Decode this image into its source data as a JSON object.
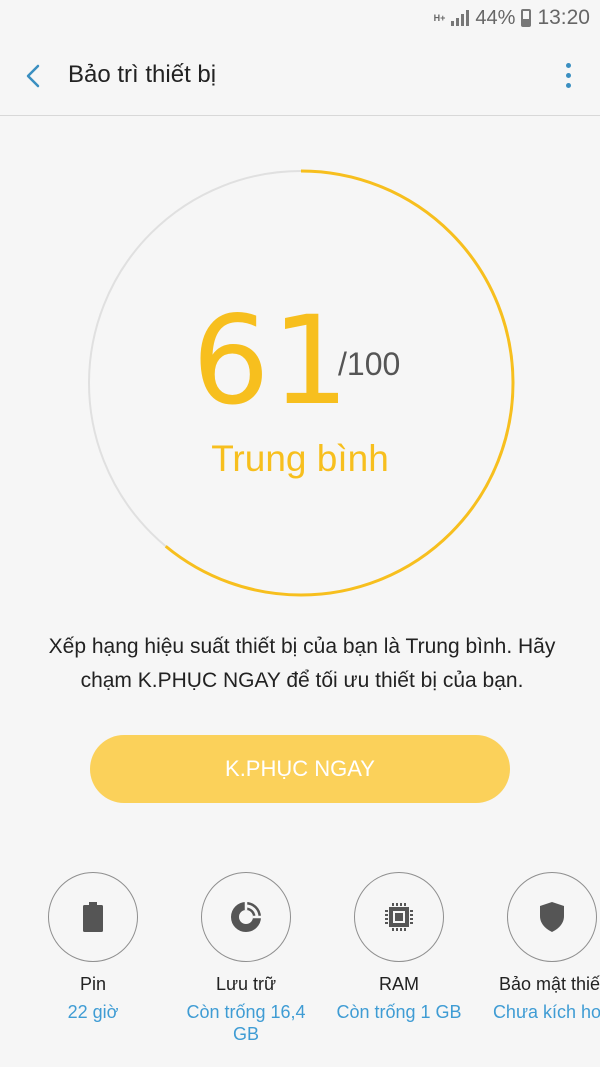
{
  "status_bar": {
    "network": "H+",
    "battery": "44%",
    "time": "13:20"
  },
  "header": {
    "title": "Bảo trì thiết bị",
    "back_icon": "chevron-left-icon",
    "more_icon": "more-vert-icon"
  },
  "score": {
    "value": "61",
    "max": "/100",
    "level": "Trung bình",
    "fraction": 0.61,
    "ring_color": "#f7bf1e",
    "track_color": "#e0e0e0"
  },
  "description": "Xếp hạng hiệu suất thiết bị của bạn là Trung bình. Hãy chạm K.PHỤC NGAY để tối ưu thiết bị của bạn.",
  "fix_button": {
    "label": "K.PHỤC NGAY",
    "color": "#fbd15a"
  },
  "categories": [
    {
      "label": "Pin",
      "value": "22 giờ",
      "icon": "battery-icon"
    },
    {
      "label": "Lưu trữ",
      "value": "Còn trống 16,4 GB",
      "icon": "storage-icon"
    },
    {
      "label": "RAM",
      "value": "Còn trống 1 GB",
      "icon": "ram-chip-icon"
    },
    {
      "label": "Bảo mật thiết",
      "value": "Chưa kích hoạ",
      "icon": "shield-icon"
    }
  ],
  "accent_color": "#3f9cd4"
}
